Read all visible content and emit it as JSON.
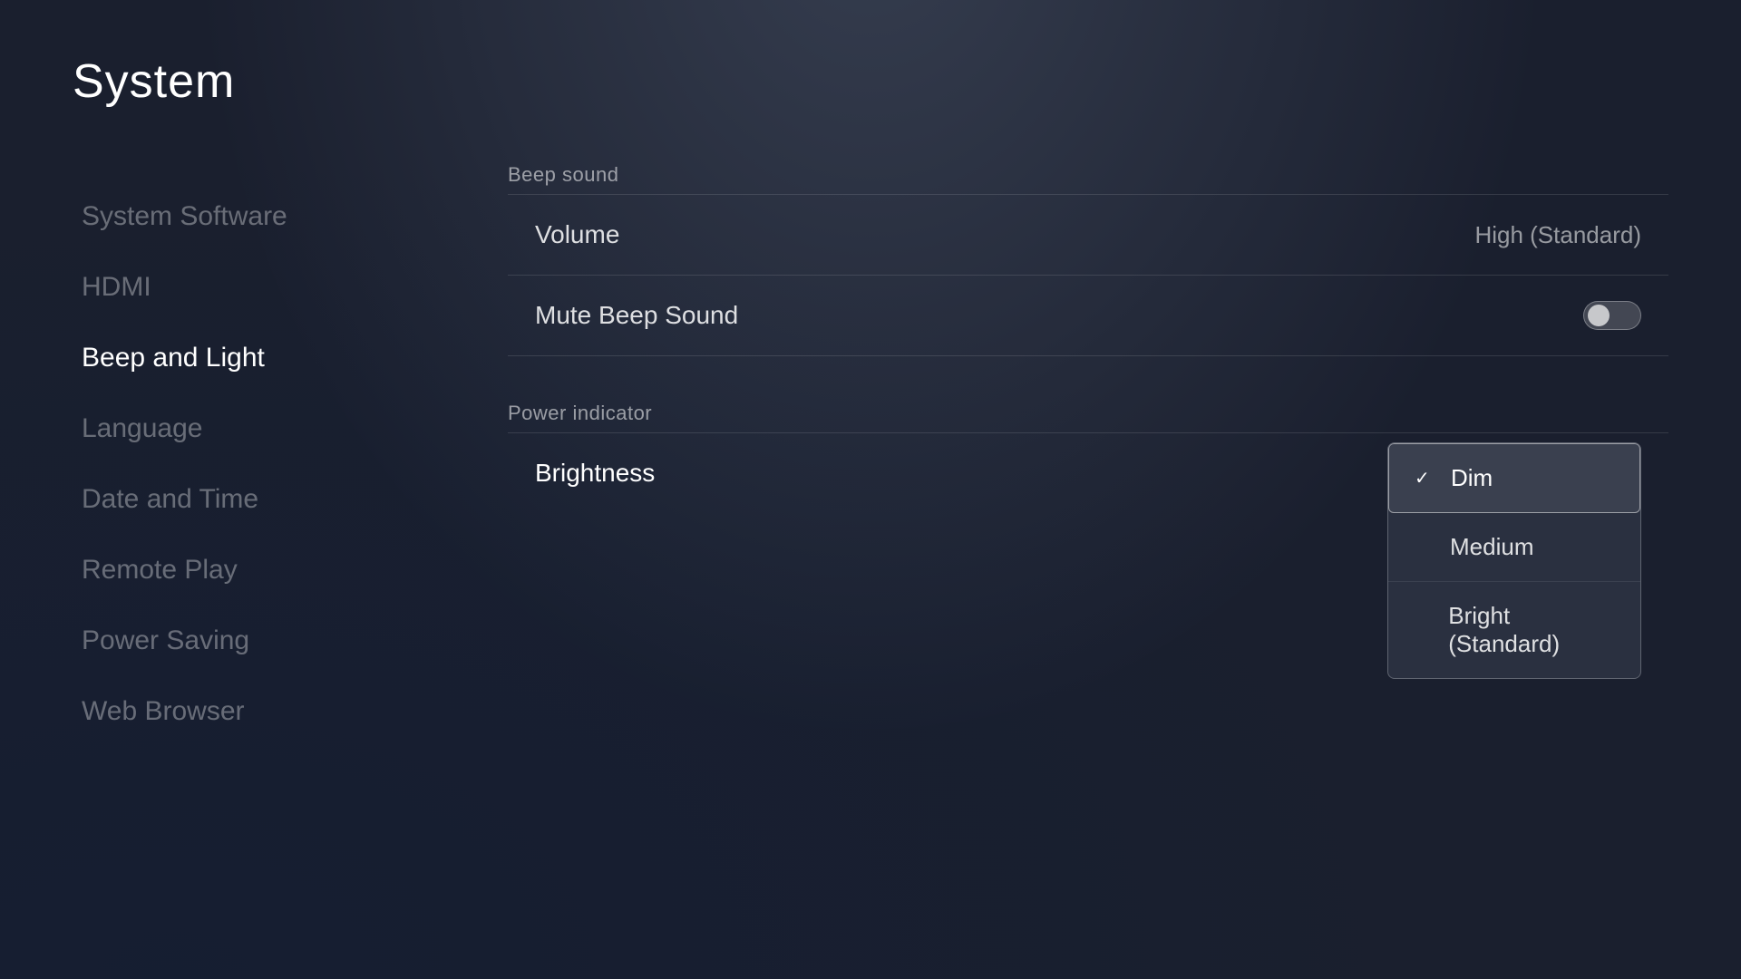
{
  "page": {
    "title": "System"
  },
  "sidebar": {
    "items": [
      {
        "id": "system-software",
        "label": "System Software",
        "active": false
      },
      {
        "id": "hdmi",
        "label": "HDMI",
        "active": false
      },
      {
        "id": "beep-and-light",
        "label": "Beep and Light",
        "active": true
      },
      {
        "id": "language",
        "label": "Language",
        "active": false
      },
      {
        "id": "date-and-time",
        "label": "Date and Time",
        "active": false
      },
      {
        "id": "remote-play",
        "label": "Remote Play",
        "active": false
      },
      {
        "id": "power-saving",
        "label": "Power Saving",
        "active": false
      },
      {
        "id": "web-browser",
        "label": "Web Browser",
        "active": false
      }
    ]
  },
  "beep_sound": {
    "section_label": "Beep sound",
    "volume_label": "Volume",
    "volume_value": "High (Standard)",
    "mute_label": "Mute Beep Sound"
  },
  "power_indicator": {
    "section_label": "Power indicator",
    "brightness_label": "Brightness",
    "dropdown": {
      "options": [
        {
          "id": "dim",
          "label": "Dim",
          "selected": true
        },
        {
          "id": "medium",
          "label": "Medium",
          "selected": false
        },
        {
          "id": "bright-standard",
          "label": "Bright (Standard)",
          "selected": false
        }
      ]
    }
  },
  "icons": {
    "checkmark": "✓"
  }
}
